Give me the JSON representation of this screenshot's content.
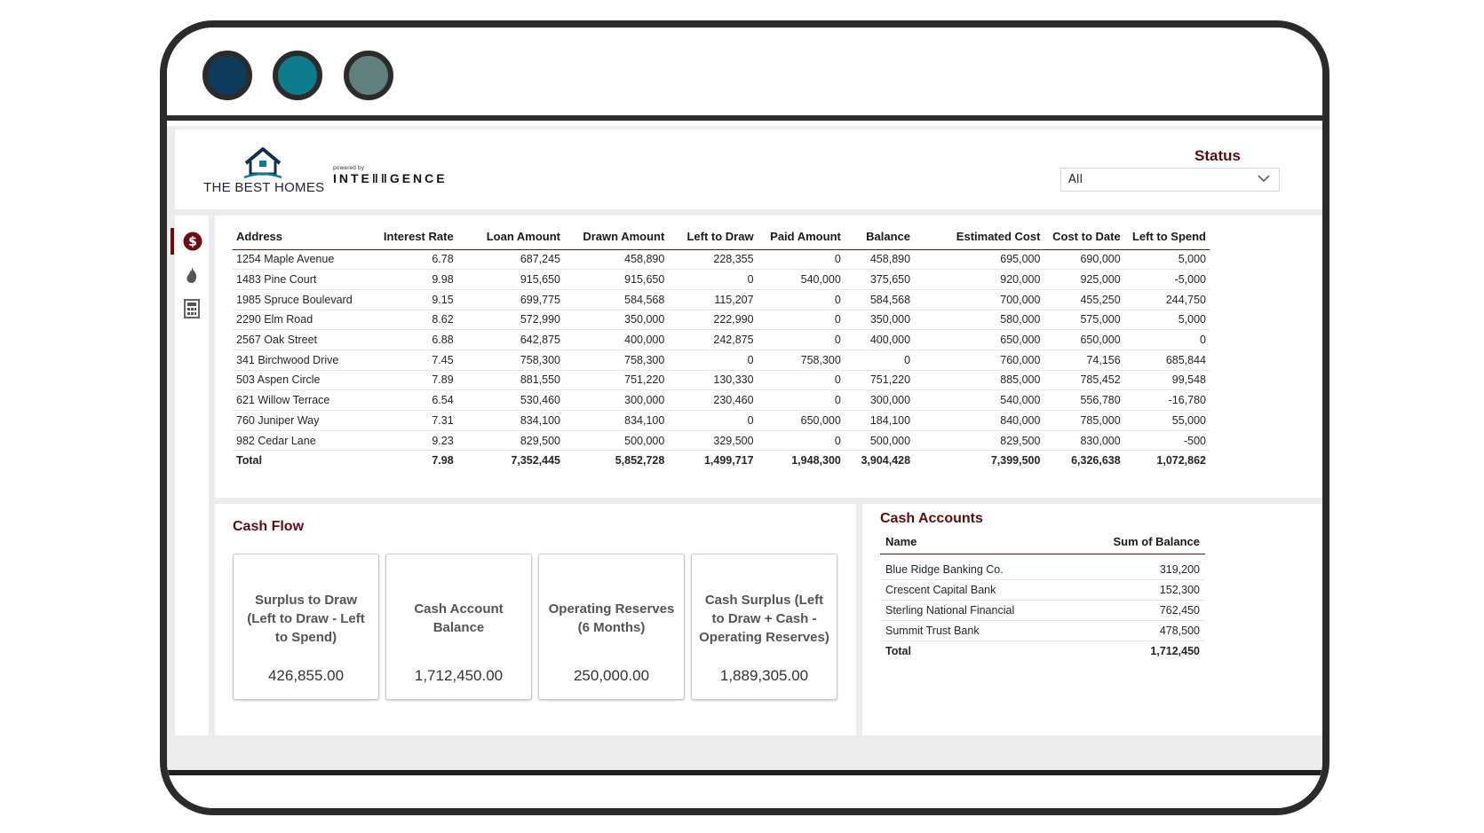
{
  "header": {
    "brand": "THE BEST HOMES",
    "powered_by": "powered by",
    "partner": "INTE‖‖GENCE",
    "status_label": "Status",
    "status_value": "All"
  },
  "nav": {
    "items": [
      "dollar-icon",
      "fire-icon",
      "calculator-icon"
    ]
  },
  "loans": {
    "columns": [
      "Address",
      "Interest Rate",
      "Loan Amount",
      "Drawn Amount",
      "Left to Draw",
      "Paid Amount",
      "Balance",
      "Estimated Cost",
      "Cost to Date",
      "Left to Spend"
    ],
    "rows": [
      [
        "1254 Maple Avenue",
        "6.78",
        "687,245",
        "458,890",
        "228,355",
        "0",
        "458,890",
        "695,000",
        "690,000",
        "5,000"
      ],
      [
        "1483 Pine Court",
        "9.98",
        "915,650",
        "915,650",
        "0",
        "540,000",
        "375,650",
        "920,000",
        "925,000",
        "-5,000"
      ],
      [
        "1985 Spruce Boulevard",
        "9.15",
        "699,775",
        "584,568",
        "115,207",
        "0",
        "584,568",
        "700,000",
        "455,250",
        "244,750"
      ],
      [
        "2290 Elm Road",
        "8.62",
        "572,990",
        "350,000",
        "222,990",
        "0",
        "350,000",
        "580,000",
        "575,000",
        "5,000"
      ],
      [
        "2567 Oak Street",
        "6.88",
        "642,875",
        "400,000",
        "242,875",
        "0",
        "400,000",
        "650,000",
        "650,000",
        "0"
      ],
      [
        "341 Birchwood Drive",
        "7.45",
        "758,300",
        "758,300",
        "0",
        "758,300",
        "0",
        "760,000",
        "74,156",
        "685,844"
      ],
      [
        "503 Aspen Circle",
        "7.89",
        "881,550",
        "751,220",
        "130,330",
        "0",
        "751,220",
        "885,000",
        "785,452",
        "99,548"
      ],
      [
        "621 Willow Terrace",
        "6.54",
        "530,460",
        "300,000",
        "230,460",
        "0",
        "300,000",
        "540,000",
        "556,780",
        "-16,780"
      ],
      [
        "760 Juniper Way",
        "7.31",
        "834,100",
        "834,100",
        "0",
        "650,000",
        "184,100",
        "840,000",
        "785,000",
        "55,000"
      ],
      [
        "982 Cedar Lane",
        "9.23",
        "829,500",
        "500,000",
        "329,500",
        "0",
        "500,000",
        "829,500",
        "830,000",
        "-500"
      ]
    ],
    "total": [
      "Total",
      "7.98",
      "7,352,445",
      "5,852,728",
      "1,499,717",
      "1,948,300",
      "3,904,428",
      "7,399,500",
      "6,326,638",
      "1,072,862"
    ]
  },
  "cash_flow": {
    "title": "Cash Flow",
    "cards": [
      {
        "title": "Surplus to Draw (Left to Draw - Left to Spend)",
        "value": "426,855.00"
      },
      {
        "title": "Cash Account Balance",
        "value": "1,712,450.00"
      },
      {
        "title": "Operating Reserves (6 Months)",
        "value": "250,000.00"
      },
      {
        "title": "Cash Surplus (Left to Draw + Cash - Operating Reserves)",
        "value": "1,889,305.00"
      }
    ]
  },
  "cash_accounts": {
    "title": "Cash Accounts",
    "columns": [
      "Name",
      "Sum of Balance"
    ],
    "rows": [
      [
        "Blue Ridge Banking Co.",
        "319,200"
      ],
      [
        "Crescent Capital Bank",
        "152,300"
      ],
      [
        "Sterling National Financial",
        "762,450"
      ],
      [
        "Summit Trust Bank",
        "478,500"
      ]
    ],
    "total": [
      "Total",
      "1,712,450"
    ]
  },
  "colors": {
    "accent": "#6b0e14",
    "window_dot_1": "#0e3a5c",
    "window_dot_2": "#0e7c8c",
    "window_dot_3": "#5f807d"
  }
}
